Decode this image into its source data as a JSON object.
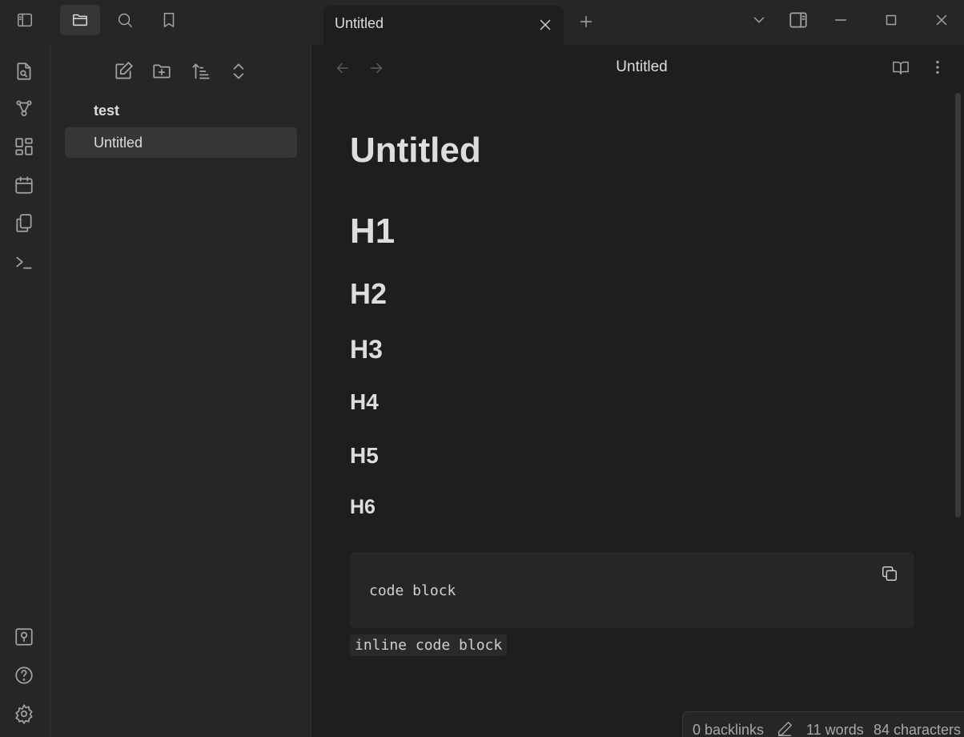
{
  "window": {
    "tab_title": "Untitled"
  },
  "explorer": {
    "folder": "test",
    "file": "Untitled"
  },
  "view": {
    "title": "Untitled"
  },
  "document": {
    "title": "Untitled",
    "headings": [
      "H1",
      "H2",
      "H3",
      "H4",
      "H5",
      "H6"
    ],
    "code_block": "code block",
    "inline_code": "inline code block"
  },
  "status": {
    "backlinks": "0 backlinks",
    "words": "11 words",
    "characters": "84 characters"
  },
  "icons": {
    "titlebar": [
      "sidebar-toggle-icon",
      "folder-icon",
      "search-icon",
      "bookmark-icon",
      "close-icon",
      "plus-icon",
      "chevron-down-icon",
      "right-sidebar-icon",
      "minimize-icon",
      "maximize-icon",
      "window-close-icon"
    ],
    "ribbon": [
      "quick-switcher-icon",
      "graph-icon",
      "canvas-icon",
      "calendar-icon",
      "templates-icon",
      "terminal-icon",
      "vault-icon",
      "help-icon",
      "settings-icon"
    ],
    "explorer_tools": [
      "new-note-icon",
      "new-folder-icon",
      "sort-icon",
      "collapse-icon"
    ],
    "view": [
      "arrow-left-icon",
      "arrow-right-icon",
      "book-open-icon",
      "more-vertical-icon",
      "copy-icon",
      "pencil-icon"
    ]
  },
  "colors": {
    "background": "#1e1e1e",
    "panel": "#262626",
    "active_item": "#363636",
    "text": "#dcddde",
    "muted": "#a3a3a3"
  }
}
